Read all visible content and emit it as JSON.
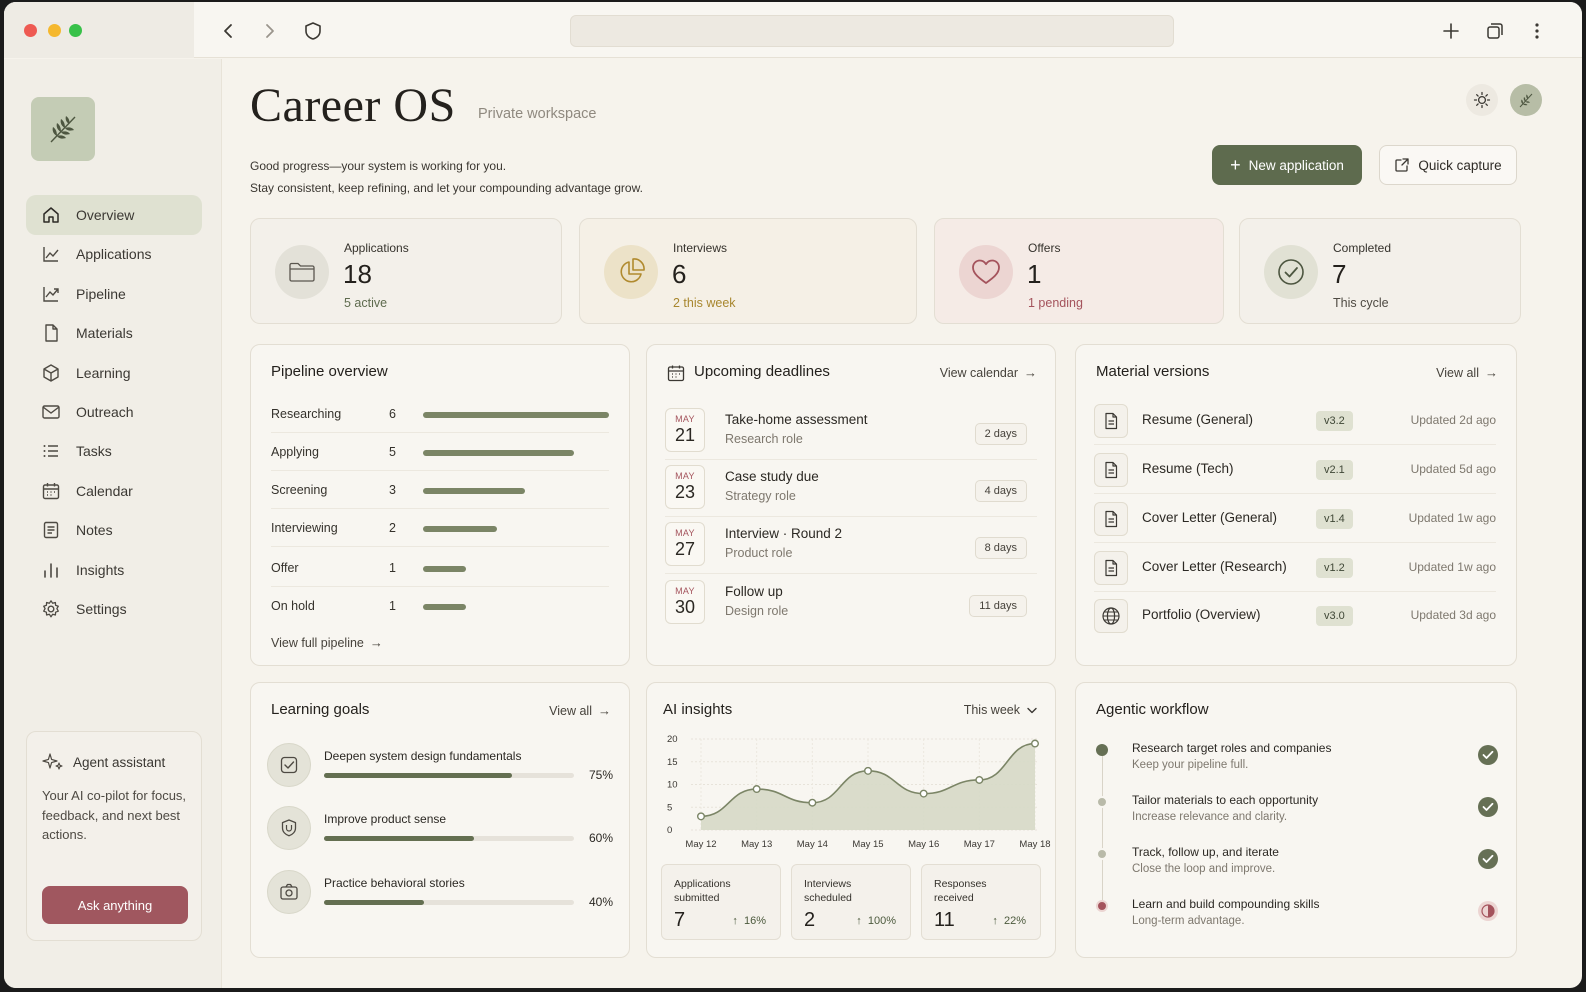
{
  "header": {
    "title": "Career OS",
    "tag": "Private workspace",
    "greeting_line1": "Good progress—your system is working for you.",
    "greeting_line2": "Stay consistent, keep refining, and let your compounding advantage grow.",
    "new_application": "New application",
    "quick_capture": "Quick capture"
  },
  "sidebar": {
    "items": [
      {
        "label": "Overview",
        "icon": "home-icon"
      },
      {
        "label": "Applications",
        "icon": "chart-line-icon"
      },
      {
        "label": "Pipeline",
        "icon": "trend-icon"
      },
      {
        "label": "Materials",
        "icon": "document-icon"
      },
      {
        "label": "Learning",
        "icon": "cube-icon"
      },
      {
        "label": "Outreach",
        "icon": "mail-icon"
      },
      {
        "label": "Tasks",
        "icon": "list-icon"
      },
      {
        "label": "Calendar",
        "icon": "calendar-icon"
      },
      {
        "label": "Notes",
        "icon": "notes-icon"
      },
      {
        "label": "Insights",
        "icon": "bar-chart-icon"
      },
      {
        "label": "Settings",
        "icon": "gear-icon"
      }
    ],
    "agent": {
      "title": "Agent assistant",
      "description": "Your AI co-pilot for focus, feedback, and next best actions.",
      "button": "Ask anything"
    }
  },
  "stats": [
    {
      "label": "Applications",
      "value": "18",
      "sub": "5 active",
      "sub_color": "#5e6b4e"
    },
    {
      "label": "Interviews",
      "value": "6",
      "sub": "2 this week",
      "sub_color": "#a8872f"
    },
    {
      "label": "Offers",
      "value": "1",
      "sub": "1 pending",
      "sub_color": "#a4535c"
    },
    {
      "label": "Completed",
      "value": "7",
      "sub": "This cycle",
      "sub_color": "#4e4a43"
    }
  ],
  "pipeline": {
    "title": "Pipeline overview",
    "link": "View full pipeline",
    "rows": [
      {
        "label": "Researching",
        "count": "6",
        "fraction": 1.0
      },
      {
        "label": "Applying",
        "count": "5",
        "fraction": 0.81
      },
      {
        "label": "Screening",
        "count": "3",
        "fraction": 0.55
      },
      {
        "label": "Interviewing",
        "count": "2",
        "fraction": 0.4
      },
      {
        "label": "Offer",
        "count": "1",
        "fraction": 0.23
      },
      {
        "label": "On hold",
        "count": "1",
        "fraction": 0.23
      }
    ]
  },
  "deadlines": {
    "title": "Upcoming deadlines",
    "link": "View calendar",
    "rows": [
      {
        "month": "MAY",
        "day": "21",
        "title": "Take-home assessment",
        "sub": "Research role",
        "badge": "2 days"
      },
      {
        "month": "MAY",
        "day": "23",
        "title": "Case study due",
        "sub": "Strategy role",
        "badge": "4 days"
      },
      {
        "month": "MAY",
        "day": "27",
        "title": "Interview · Round 2",
        "sub": "Product role",
        "badge": "8 days"
      },
      {
        "month": "MAY",
        "day": "30",
        "title": "Follow up",
        "sub": "Design role",
        "badge": "11 days"
      }
    ]
  },
  "materials": {
    "title": "Material versions",
    "link": "View all",
    "rows": [
      {
        "name": "Resume (General)",
        "version": "v3.2",
        "updated": "Updated 2d ago",
        "icon": "document-icon"
      },
      {
        "name": "Resume (Tech)",
        "version": "v2.1",
        "updated": "Updated 5d ago",
        "icon": "document-icon"
      },
      {
        "name": "Cover Letter (General)",
        "version": "v1.4",
        "updated": "Updated 1w ago",
        "icon": "document-icon"
      },
      {
        "name": "Cover Letter (Research)",
        "version": "v1.2",
        "updated": "Updated 1w ago",
        "icon": "document-icon"
      },
      {
        "name": "Portfolio (Overview)",
        "version": "v3.0",
        "updated": "Updated 3d ago",
        "icon": "globe-icon"
      }
    ]
  },
  "learning": {
    "title": "Learning goals",
    "link": "View all",
    "rows": [
      {
        "title": "Deepen system design fundamentals",
        "pct": "75%",
        "fraction": 0.75,
        "icon": "checklist-icon"
      },
      {
        "title": "Improve product sense",
        "pct": "60%",
        "fraction": 0.6,
        "icon": "shield-icon"
      },
      {
        "title": "Practice behavioral stories",
        "pct": "40%",
        "fraction": 0.4,
        "icon": "camera-icon"
      }
    ]
  },
  "insights": {
    "title": "AI insights",
    "period": "This week",
    "stats": [
      {
        "label": "Applications submitted",
        "value": "7",
        "delta": "16%"
      },
      {
        "label": "Interviews scheduled",
        "value": "2",
        "delta": "100%"
      },
      {
        "label": "Responses received",
        "value": "11",
        "delta": "22%"
      }
    ]
  },
  "chart_data": {
    "type": "area",
    "x": [
      "May 12",
      "May 13",
      "May 14",
      "May 15",
      "May 16",
      "May 17",
      "May 18"
    ],
    "values": [
      3,
      9,
      6,
      13,
      8,
      11,
      19
    ],
    "yticks": [
      "20",
      "15",
      "10",
      "5",
      "0"
    ],
    "ylim": [
      0,
      20
    ],
    "grid": true,
    "color": "#7b8566"
  },
  "workflow": {
    "title": "Agentic workflow",
    "rows": [
      {
        "title": "Research target roles and companies",
        "sub": "Keep your pipeline full.",
        "status": "done"
      },
      {
        "title": "Tailor materials to each opportunity",
        "sub": "Increase relevance and clarity.",
        "status": "done"
      },
      {
        "title": "Track, follow up, and iterate",
        "sub": "Close the loop and improve.",
        "status": "done"
      },
      {
        "title": "Learn and build compounding skills",
        "sub": "Long-term advantage.",
        "status": "in-progress"
      }
    ]
  },
  "colors": {
    "accent": "#5e6b4e",
    "rose": "#a0575f",
    "background": "#f6f3ec"
  }
}
